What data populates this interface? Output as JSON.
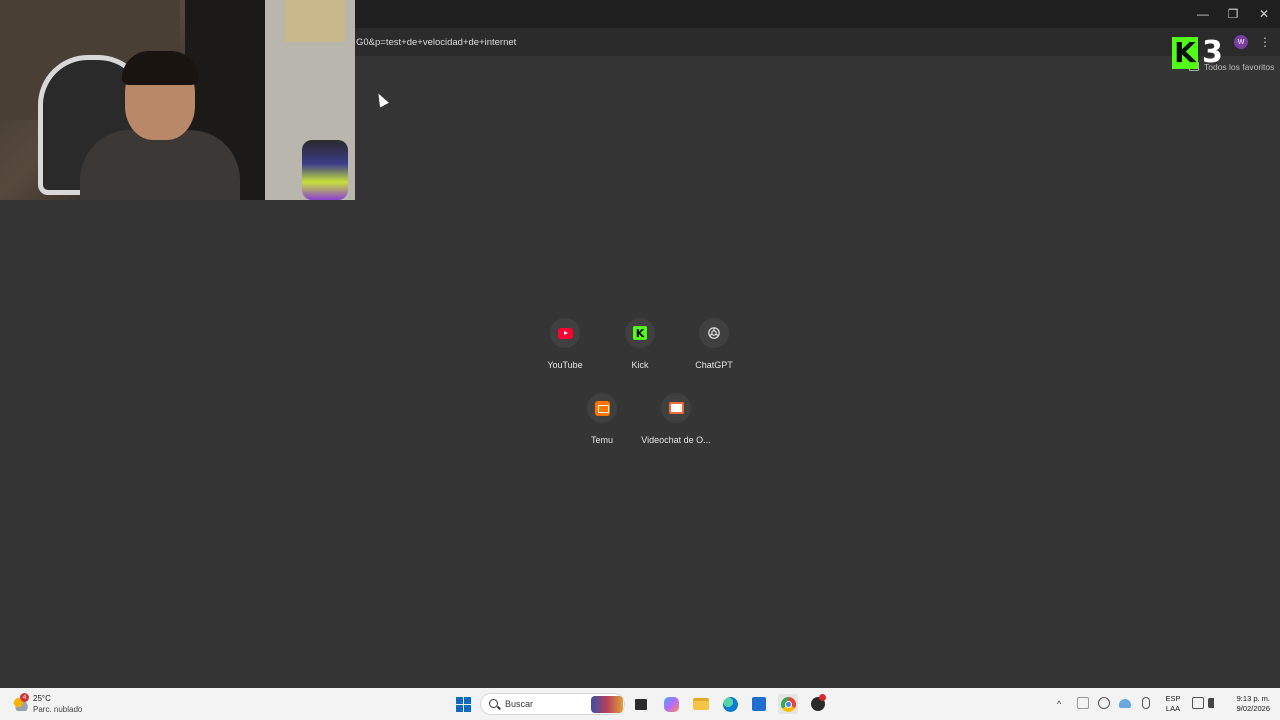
{
  "browser": {
    "url_fragment": "G0&p=test+de+velocidad+de+internet",
    "profile_initial": "W",
    "favorites_label": "Todos los favoritos",
    "window_controls": {
      "minimize": "—",
      "maximize": "❐",
      "close": "✕"
    },
    "menu_glyph": "⋮"
  },
  "overlay": {
    "k3_k": "K",
    "k3_num": "3"
  },
  "shortcuts": [
    {
      "label": "YouTube",
      "icon": "youtube-icon"
    },
    {
      "label": "Kick",
      "icon": "kick-icon",
      "glyph": "K"
    },
    {
      "label": "ChatGPT",
      "icon": "chatgpt-icon"
    },
    {
      "label": "Temu",
      "icon": "temu-icon"
    },
    {
      "label": "Videochat de O...",
      "icon": "videochat-icon"
    }
  ],
  "taskbar": {
    "weather_temp": "25°C",
    "weather_desc": "Parc. nublado",
    "weather_badge": "4",
    "search_placeholder": "Buscar",
    "lang_line1": "ESP",
    "lang_line2": "LAA",
    "time": "9:13 p. m.",
    "date": "9/02/2026",
    "tray_up": "^"
  },
  "colors": {
    "page_bg": "#353535",
    "kick_green": "#53fc18",
    "youtube_red": "#ff0033",
    "temu_orange": "#fb7701"
  }
}
